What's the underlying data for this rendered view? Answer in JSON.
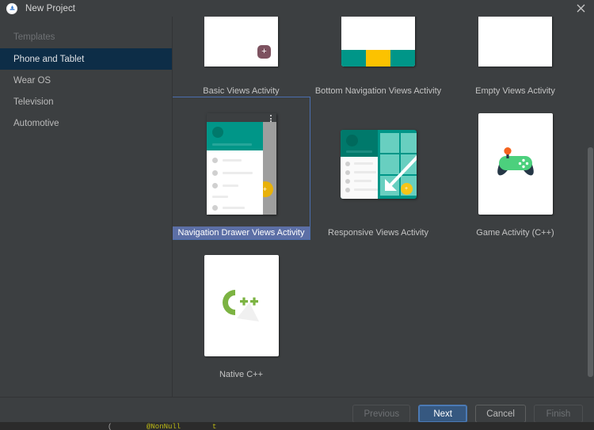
{
  "window": {
    "title": "New Project",
    "logo_icon": "android-studio-icon",
    "close_icon": "close-icon"
  },
  "sidebar": {
    "items": [
      {
        "label": "Templates",
        "selected": false,
        "header": true
      },
      {
        "label": "Phone and Tablet",
        "selected": true,
        "header": false
      },
      {
        "label": "Wear OS",
        "selected": false,
        "header": false
      },
      {
        "label": "Television",
        "selected": false,
        "header": false
      },
      {
        "label": "Automotive",
        "selected": false,
        "header": false
      }
    ]
  },
  "templates": {
    "rows": [
      [
        {
          "label": "Basic Views Activity",
          "selected": false
        },
        {
          "label": "Bottom Navigation Views Activity",
          "selected": false
        },
        {
          "label": "Empty Views Activity",
          "selected": false
        }
      ],
      [
        {
          "label": "Navigation Drawer Views Activity",
          "selected": true
        },
        {
          "label": "Responsive Views Activity",
          "selected": false
        },
        {
          "label": "Game Activity (C++)",
          "selected": false
        }
      ],
      [
        {
          "label": "Native C++",
          "selected": false
        }
      ]
    ],
    "fab_glyph": "+",
    "scrollbar_icon": "vertical-scrollbar"
  },
  "footer": {
    "previous_label": "Previous",
    "next_label": "Next",
    "cancel_label": "Cancel",
    "finish_label": "Finish"
  },
  "behind_editor": {
    "fragment_1": "(",
    "fragment_2": "@NonNull",
    "fragment_3": "t"
  },
  "colors": {
    "window_bg": "#3c3f41",
    "sidebar_selection": "#0d2d47",
    "tile_selection": "#5c6fa6",
    "tile_selection_border": "#4b6eaf",
    "primary_button": "#365880",
    "teal": "#009688",
    "amber": "#fcc200",
    "mauve": "#7d5260",
    "cpp_green": "#7cb342",
    "game_green": "#4cd07d"
  }
}
